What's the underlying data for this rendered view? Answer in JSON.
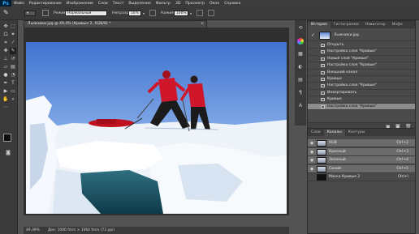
{
  "app": {
    "logo": "Ps"
  },
  "menu": [
    "Файл",
    "Редактирование",
    "Изображение",
    "Слои",
    "Текст",
    "Выделение",
    "Фильтр",
    "3D",
    "Просмотр",
    "Окно",
    "Справка"
  ],
  "options": {
    "mode_label": "Режим:",
    "mode_value": "Нормальный",
    "opacity_label": "Непрозр.:",
    "opacity_value": "50%",
    "flow_label": "Нажим:",
    "flow_value": "100%"
  },
  "document": {
    "tab_title": "Лыжники.jpg @ 49,4% (Кривые 2, RGB/8) *",
    "close": "×",
    "status_zoom": "49,39%",
    "status_info": "Док: 1000 fmm × 1064 fmm (72 ppi)"
  },
  "history": {
    "tabs": [
      "История",
      "Гистограмма",
      "Навигатор",
      "Инфо"
    ],
    "snapshot": "Лыжники.jpg",
    "items": [
      "Открыть",
      "Настройка слоя \"Кривые\"",
      "Новый слой \"Кривые\"",
      "Настройка слоя \"Кривые\"",
      "Внешний канал",
      "Кривые",
      "Настройка слоя \"Кривые\"",
      "Инвертировать",
      "Кривые",
      "Настройка слоя \"Кривые\""
    ]
  },
  "channels": {
    "tabs": [
      "Слои",
      "Каналы",
      "Контуры"
    ],
    "rows": [
      {
        "label": "RGB",
        "key": "Ctrl+2"
      },
      {
        "label": "Красный",
        "key": "Ctrl+3"
      },
      {
        "label": "Зеленый",
        "key": "Ctrl+4"
      },
      {
        "label": "Синий",
        "key": "Ctrl+5"
      },
      {
        "label": "Маска Кривые 2",
        "key": "Ctrl+\\"
      }
    ]
  },
  "colors": {
    "accent": "#31a8ff",
    "sky": "#6f9be0",
    "jacket": "#d0162a"
  }
}
